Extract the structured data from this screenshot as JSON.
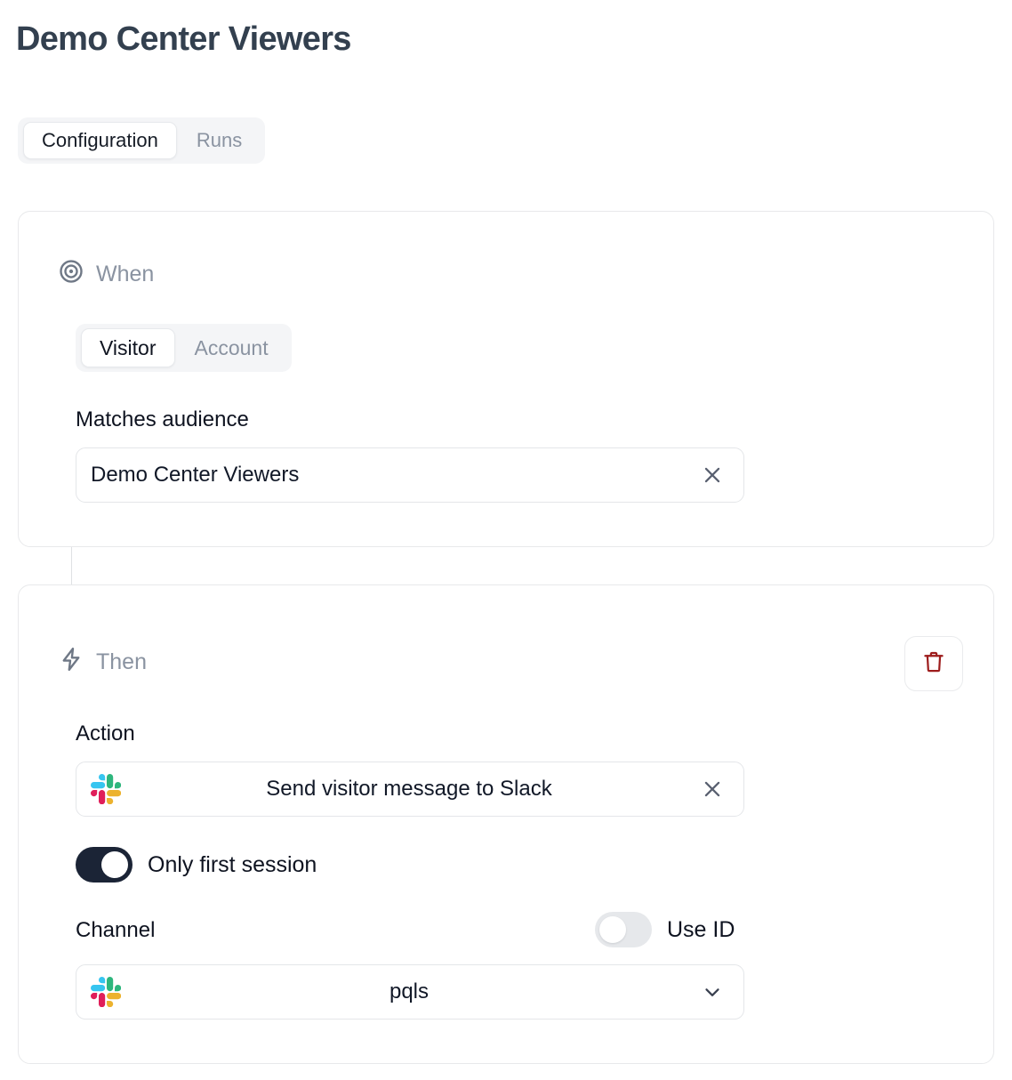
{
  "page": {
    "title": "Demo Center Viewers"
  },
  "tabs": [
    {
      "label": "Configuration",
      "active": true
    },
    {
      "label": "Runs",
      "active": false
    }
  ],
  "when_card": {
    "icon": "target-icon",
    "section_label": "When",
    "subject_tabs": [
      {
        "label": "Visitor",
        "active": true
      },
      {
        "label": "Account",
        "active": false
      }
    ],
    "audience_field_label": "Matches audience",
    "audience_value": "Demo Center Viewers",
    "clear_icon": "close-icon"
  },
  "then_card": {
    "icon": "lightning-bolt-icon",
    "section_label": "Then",
    "delete_icon": "trash-icon",
    "delete_icon_color": "#9D1C1C",
    "action_field_label": "Action",
    "action_value": "Send visitor message to Slack",
    "action_icon": "slack-icon",
    "clear_icon": "close-icon",
    "first_session_toggle": {
      "label": "Only first session",
      "state": "on"
    },
    "channel_field_label": "Channel",
    "use_id_toggle": {
      "label": "Use ID",
      "state": "off"
    },
    "channel_value": "pqls",
    "channel_icon": "slack-icon",
    "channel_dropdown_icon": "chevron-down-icon"
  },
  "colors": {
    "title": "#33404F",
    "muted": "#8A93A1",
    "text": "#0E1320",
    "border": "#E8E9EB",
    "track_on": "#1B2436",
    "track_off": "#E6E8EB",
    "danger": "#9D1C1C",
    "slack_blue": "#36C5F0",
    "slack_green": "#2EB67D",
    "slack_red": "#E01E5A",
    "slack_yellow": "#ECB22E"
  }
}
